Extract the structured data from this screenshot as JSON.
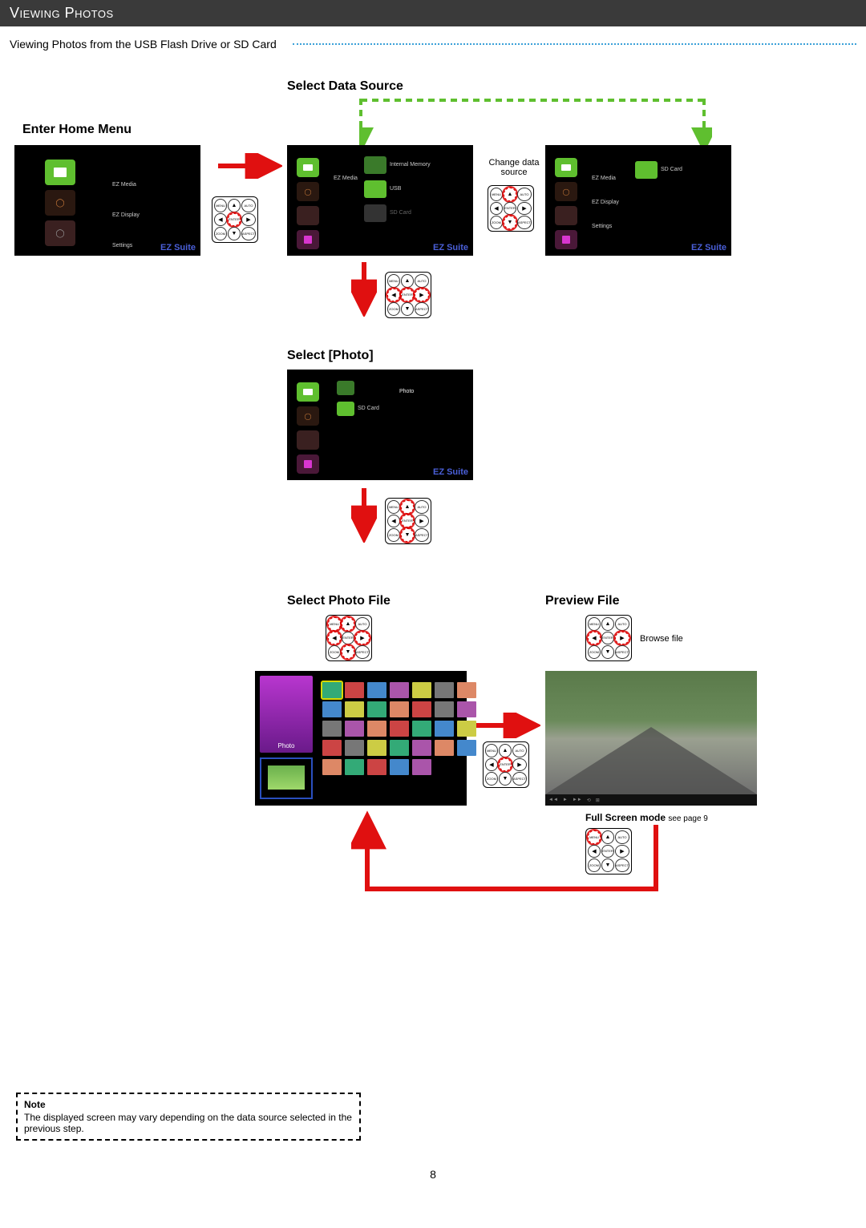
{
  "header": "Viewing Photos",
  "subhead": "Viewing Photos from the USB Flash Drive or SD Card",
  "steps": {
    "enter_home": "Enter Home Menu",
    "select_source": "Select Data Source",
    "select_photo": "Select [Photo]",
    "select_file": "Select Photo File",
    "preview_file": "Preview File"
  },
  "captions": {
    "change_source": "Change data source",
    "browse_file": "Browse file",
    "fullscreen": "Full Screen mode",
    "fullscreen_ref": "see page 9"
  },
  "brand": "EZ Suite",
  "menu": {
    "ez_media": "EZ Media",
    "ez_display": "EZ Display",
    "settings": "Settings",
    "usb": "USB",
    "sd_card": "SD Card",
    "internal": "Internal Memory",
    "photo": "Photo"
  },
  "remote_labels": {
    "menu": "MENU",
    "auto": "AUTO",
    "enter": "ENTER",
    "zoom": "ZOOM",
    "aspect": "ASPECT"
  },
  "note": {
    "title": "Note",
    "body": "The displayed screen may vary depending on the data source selected in the previous step."
  },
  "page_number": "8"
}
